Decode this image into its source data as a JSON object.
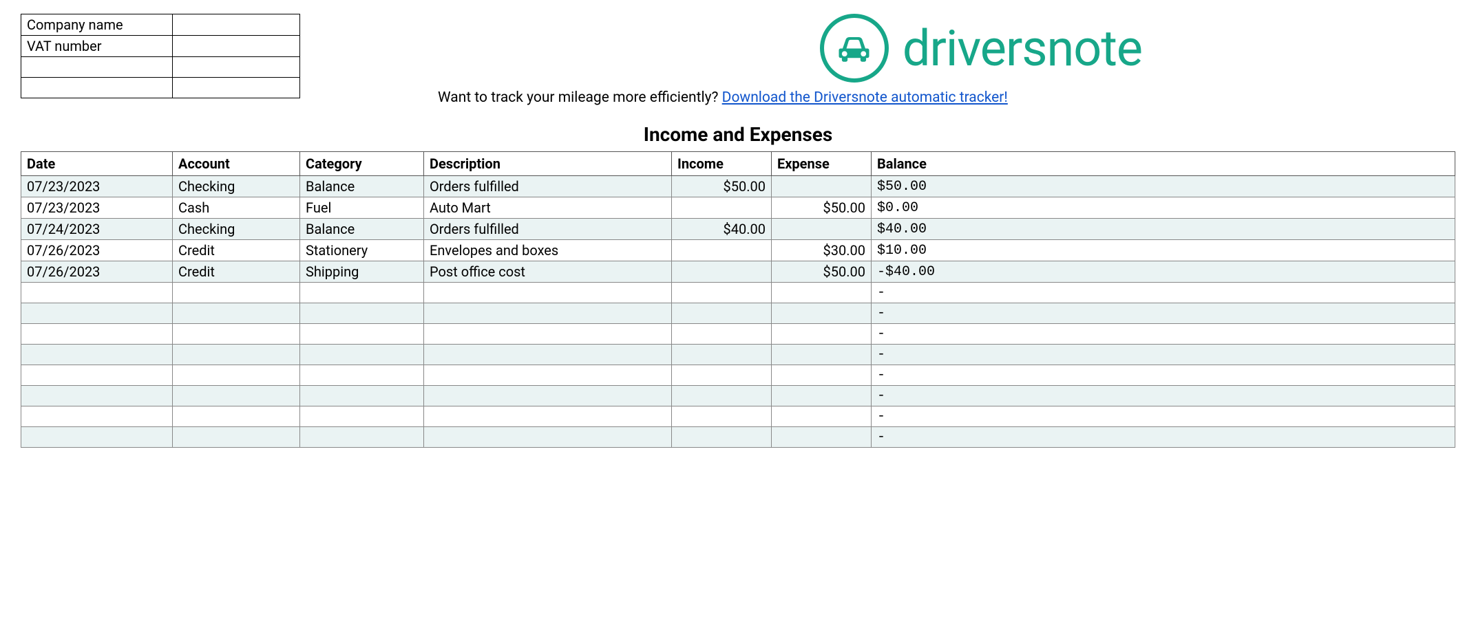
{
  "company_info": {
    "row1_label": "Company name",
    "row1_value": "",
    "row2_label": "VAT number",
    "row2_value": "",
    "row3_label": "",
    "row3_value": "",
    "row4_label": "",
    "row4_value": ""
  },
  "brand": {
    "name": "driversnote",
    "accent_color": "#17a789"
  },
  "promo": {
    "text": "Want to track your mileage more efficiently? ",
    "link_text": "Download the Driversnote automatic tracker!"
  },
  "main_title": "Income and Expenses",
  "ledger": {
    "headers": {
      "date": "Date",
      "account": "Account",
      "category": "Category",
      "description": "Description",
      "income": "Income",
      "expense": "Expense",
      "balance": "Balance"
    },
    "rows": [
      {
        "date": "07/23/2023",
        "account": "Checking",
        "category": "Balance",
        "description": "Orders fulfilled",
        "income": "$50.00",
        "expense": "",
        "balance": "$50.00"
      },
      {
        "date": "07/23/2023",
        "account": "Cash",
        "category": "Fuel",
        "description": "Auto Mart",
        "income": "",
        "expense": "$50.00",
        "balance": "$0.00"
      },
      {
        "date": "07/24/2023",
        "account": "Checking",
        "category": "Balance",
        "description": "Orders fulfilled",
        "income": "$40.00",
        "expense": "",
        "balance": "$40.00"
      },
      {
        "date": "07/26/2023",
        "account": "Credit",
        "category": "Stationery",
        "description": "Envelopes and boxes",
        "income": "",
        "expense": "$30.00",
        "balance": "$10.00"
      },
      {
        "date": "07/26/2023",
        "account": "Credit",
        "category": "Shipping",
        "description": "Post office cost",
        "income": "",
        "expense": "$50.00",
        "balance": "-$40.00"
      },
      {
        "date": "",
        "account": "",
        "category": "",
        "description": "",
        "income": "",
        "expense": "",
        "balance": " -"
      },
      {
        "date": "",
        "account": "",
        "category": "",
        "description": "",
        "income": "",
        "expense": "",
        "balance": " -"
      },
      {
        "date": "",
        "account": "",
        "category": "",
        "description": "",
        "income": "",
        "expense": "",
        "balance": " -"
      },
      {
        "date": "",
        "account": "",
        "category": "",
        "description": "",
        "income": "",
        "expense": "",
        "balance": " -"
      },
      {
        "date": "",
        "account": "",
        "category": "",
        "description": "",
        "income": "",
        "expense": "",
        "balance": " -"
      },
      {
        "date": "",
        "account": "",
        "category": "",
        "description": "",
        "income": "",
        "expense": "",
        "balance": " -"
      },
      {
        "date": "",
        "account": "",
        "category": "",
        "description": "",
        "income": "",
        "expense": "",
        "balance": " -"
      },
      {
        "date": "",
        "account": "",
        "category": "",
        "description": "",
        "income": "",
        "expense": "",
        "balance": " -"
      }
    ]
  }
}
